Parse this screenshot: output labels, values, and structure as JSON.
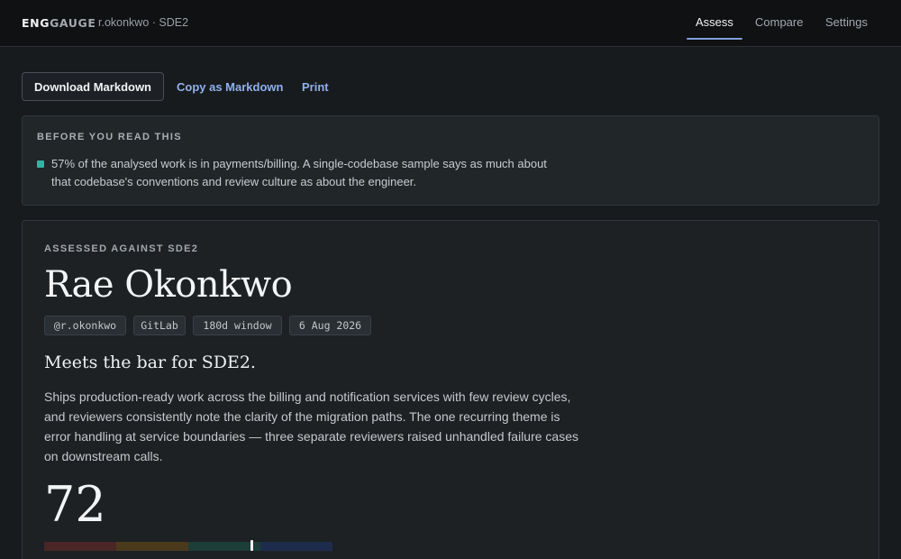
{
  "app": {
    "brand_part1": "ENG",
    "brand_part2": "GAUGE",
    "context": "r.okonkwo · SDE2"
  },
  "nav": {
    "items": [
      {
        "label": "Assess",
        "active": true
      },
      {
        "label": "Compare",
        "active": false
      },
      {
        "label": "Settings",
        "active": false
      }
    ]
  },
  "actions": {
    "download_label": "Download Markdown",
    "copy_label": "Copy as Markdown",
    "print_label": "Print"
  },
  "notice": {
    "title": "BEFORE YOU READ THIS",
    "text": "57% of the analysed work is in payments/billing. A single-codebase sample says as much about that codebase's conventions and review culture as about the engineer."
  },
  "assessment": {
    "eyebrow": "ASSESSED AGAINST SDE2",
    "name": "Rae Okonkwo",
    "chips": [
      "@r.okonkwo",
      "GitLab",
      "180d window",
      "6 Aug 2026"
    ],
    "verdict": "Meets the bar for SDE2.",
    "summary": "Ships production-ready work across the billing and notification services with few review cycles, and reviewers consistently note the clarity of the migration paths. The one recurring theme is error handling at service boundaries — three separate reviewers raised unhandled failure cases on downstream calls.",
    "score": "72",
    "score_value": 72,
    "score_max": 100
  },
  "colors": {
    "accent": "#8fb1ec",
    "notice_bullet": "#2bb7a3",
    "band_low": "#4a2626",
    "band_mid_low": "#4a3a1c",
    "band_mid_high": "#1c3d38",
    "band_high": "#1d2c4c"
  }
}
